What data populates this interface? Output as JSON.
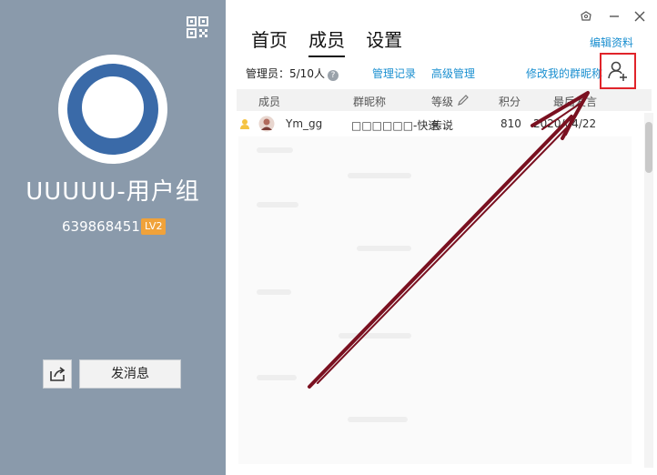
{
  "left_panel": {
    "group_name": "UUUUU-用户组",
    "group_id": "639868451",
    "level_badge": "LV2",
    "send_message_label": "发消息",
    "background_color": "#8a9aab"
  },
  "header": {
    "tabs": [
      {
        "label": "首页",
        "active": false
      },
      {
        "label": "成员",
        "active": true
      },
      {
        "label": "设置",
        "active": false
      }
    ],
    "edit_profile_label": "编辑资料"
  },
  "toolbar": {
    "admin_count": "管理员：5/10人",
    "help_icon": "?",
    "manage_log_label": "管理记录",
    "advanced_manage_label": "高级管理",
    "edit_nickname_label": "修改我的群昵称"
  },
  "table": {
    "columns": [
      "成员",
      "群昵称",
      "等级",
      "积分",
      "最后发言"
    ],
    "rows": [
      {
        "member": "Ym_gg",
        "nickname": "□□□□□□-快速...",
        "level": "传说",
        "points": "810",
        "last_speak": "2020/04/22"
      }
    ]
  },
  "annotation": {
    "highlight_color": "#e0242a",
    "arrow_color": "#7a1020"
  }
}
